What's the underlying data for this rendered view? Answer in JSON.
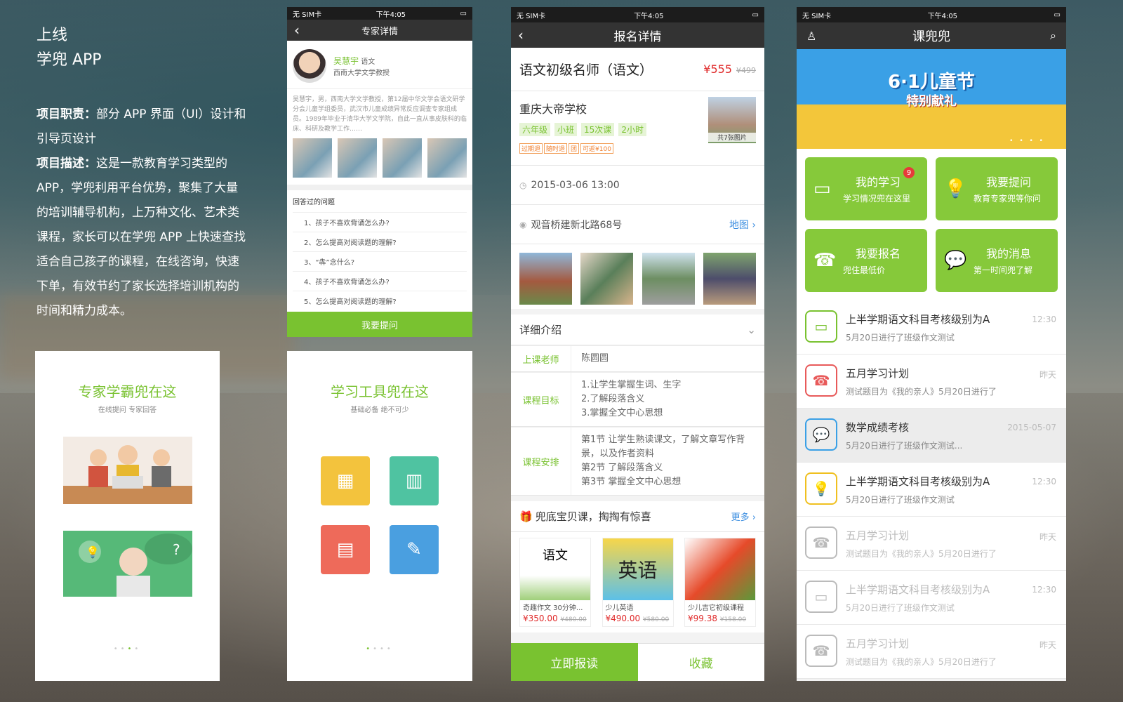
{
  "intro": {
    "line1": "上线",
    "line2": "学兜 APP",
    "role_label": "项目职责：",
    "role_text": "部分 APP 界面（UI）设计和引导页设计",
    "desc_label": "项目描述：",
    "desc_text": "这是一款教育学习类型的APP，学兜利用平台优势，聚集了大量的培训辅导机构，上万种文化、艺术类课程，家长可以在学兜 APP 上快速查找适合自己孩子的课程，在线咨询，快速下单，有效节约了家长选择培训机构的时间和精力成本。"
  },
  "expert": {
    "status_left": "无 SIM卡 ",
    "status_time": "下午4:05",
    "title": "专家详情",
    "name": "吴慧宇",
    "subject": "语文",
    "org": "西南大学文学教授",
    "bio": "吴慧宇，男，西南大学文学教授，第12届中华文学会语文研学分会儿童学组委员，武汉市儿童成绩异常反应调查专家组成员。1989年毕业于清华大学文学院，自此一直从事皮肤科的临床、科研及教学工作……",
    "questions_heading": "回答过的问题",
    "questions": [
      "1、孩子不喜欢背诵怎么办?",
      "2、怎么提高对阅读题的理解?",
      "3、“犇”念什么?",
      "4、孩子不喜欢背诵怎么办?",
      "5、怎么提高对阅读题的理解?"
    ],
    "ask_button": "我要提问"
  },
  "guide1": {
    "title": "专家学霸兜在这",
    "subtitle": "在线提问 专家回答",
    "dots": [
      "•",
      "•",
      "•",
      "•"
    ]
  },
  "guide2": {
    "title": "学习工具兜在这",
    "subtitle": "基础必备 绝不可少",
    "dots": [
      "•",
      "•",
      "•",
      "•"
    ]
  },
  "enroll": {
    "status_left": "无 SIM卡 ",
    "status_time": "下午4:05",
    "title": "报名详情",
    "course": "语文初级名师（语文）",
    "price": "¥555",
    "old_price": "¥499",
    "school": "重庆大帝学校",
    "tags": [
      "六年级",
      "小班",
      "15次课",
      "2小时"
    ],
    "rules": [
      "过期退",
      "随时退",
      "团",
      "可返¥100"
    ],
    "pic_count": "共7张图片",
    "datetime": "2015-03-06  13:00",
    "address": "观音桥建新北路68号",
    "map_link": "地图",
    "detail_title": "详细介绍",
    "teacher_label": "上课老师",
    "teacher": "陈圆圆",
    "goal_label": "课程目标",
    "goals": [
      "1.让学生掌握生词、生字",
      "2.了解段落含义",
      "3.掌握全文中心思想"
    ],
    "plan_label": "课程安排",
    "plans": [
      "第1节  让学生熟读课文，了解文章写作背景，以及作者资料",
      "第2节  了解段落含义",
      "第3节  掌握全文中心思想"
    ],
    "promo_title": "兜底宝贝课，掏掏有惊喜",
    "more": "更多",
    "books": [
      {
        "title": "奇趣作文 30分钟...",
        "price": "¥350.00",
        "old": "¥480.00",
        "cover": "语文"
      },
      {
        "title": "少儿英语",
        "price": "¥490.00",
        "old": "¥580.00",
        "cover": "英语"
      },
      {
        "title": "少儿吉它初级课程",
        "price": "¥99.38",
        "old": "¥158.00",
        "cover": ""
      }
    ],
    "enroll_button": "立即报读",
    "fav_button": "收藏"
  },
  "home": {
    "status_left": "无 SIM卡 ",
    "status_time": "下午4:05",
    "title": "课兜兜",
    "banner_title": "6·1儿童节",
    "banner_sub": "特别献礼",
    "banner_dots": "• • • •",
    "cards": [
      {
        "title": "我的学习",
        "sub": "学习情况兜在这里",
        "badge": "9",
        "icon": "▭"
      },
      {
        "title": "我要提问",
        "sub": "教育专家兜等你问",
        "badge": "",
        "icon": "💡"
      },
      {
        "title": "我要报名",
        "sub": "兜住最低价",
        "badge": "",
        "icon": "☎"
      },
      {
        "title": "我的消息",
        "sub": "第一时间兜了解",
        "badge": "",
        "icon": "💬"
      }
    ],
    "messages": [
      {
        "title": "上半学期语文科目考核级别为A",
        "sub": "5月20日进行了班级作文测试",
        "time": "12:30",
        "color": "#79c230",
        "icon": "▭"
      },
      {
        "title": "五月学习计划",
        "sub": "测试题目为《我的亲人》5月20日进行了",
        "time": "昨天",
        "color": "#e85a5a",
        "icon": "☎"
      },
      {
        "title": "数学成绩考核",
        "sub": "5月20日进行了班级作文测试...",
        "time": "2015-05-07",
        "color": "#3aa0e6",
        "icon": "💬"
      },
      {
        "title": "上半学期语文科目考核级别为A",
        "sub": "5月20日进行了班级作文测试",
        "time": "12:30",
        "color": "#f0c020",
        "icon": "💡"
      },
      {
        "title": "五月学习计划",
        "sub": "测试题目为《我的亲人》5月20日进行了",
        "time": "昨天",
        "color": "#bbbbbb",
        "icon": "☎"
      },
      {
        "title": "上半学期语文科目考核级别为A",
        "sub": "5月20日进行了班级作文测试",
        "time": "12:30",
        "color": "#bbbbbb",
        "icon": "▭"
      },
      {
        "title": "五月学习计划",
        "sub": "测试题目为《我的亲人》5月20日进行了",
        "time": "昨天",
        "color": "#bbbbbb",
        "icon": "☎"
      }
    ]
  }
}
